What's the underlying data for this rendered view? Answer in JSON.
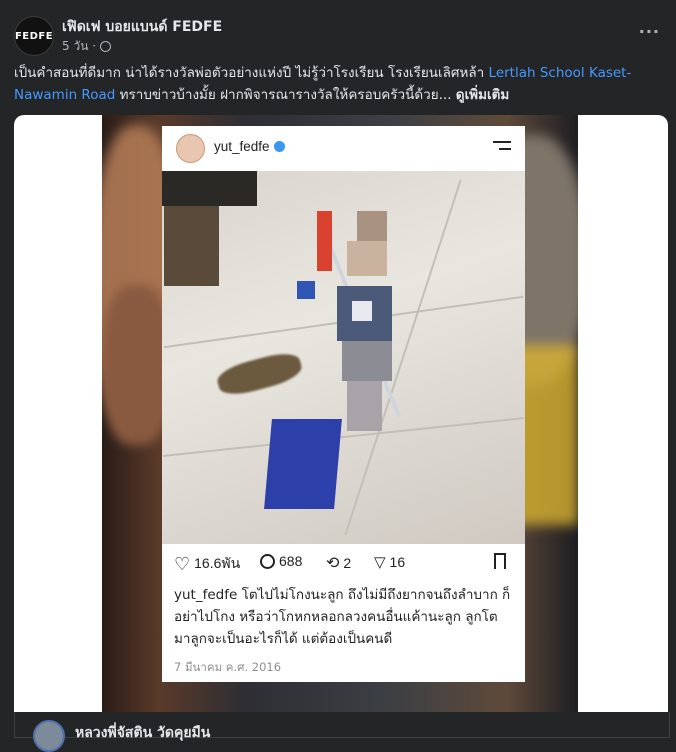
{
  "post": {
    "avatar_text": "FEDFE",
    "page_name": "เฟิดเฟ บอยแบนด์ FEDFE",
    "time": "5 วัน ·",
    "more": "···",
    "caption_text": "เป็นคำสอนที่ดีมาก น่าได้รางวัลพ่อตัวอย่างแห่งปี ไม่รู้ว่าโรงเรียน โรงเรียนเลิศหล้า ",
    "caption_link": "Lertlah School Kaset-Nawamin Road",
    "caption_text2": " ทราบข่าวบ้างมั้ย ฝากพิจารณารางวัลให้ครอบครัวนี้ด้วย... ",
    "see_more": "ดูเพิ่มเติม"
  },
  "ig": {
    "username": "yut_fedfe",
    "likes": "16.6พัน",
    "comments": "688",
    "reposts": "2",
    "shares": "16",
    "caption_user": "yut_fedfe",
    "caption": "โตไปไม่โกงนะลูก ถึงไม่มีถึงยากจนถึงลำบาก ก็อย่าไปโกง หรือว่าโกหกหลอกลวงคนอื่นแค้านะลูก ลูกโตมาลูกจะเป็นอะไรก็ได้ แต่ต้องเป็นคนดี",
    "date": "7 มีนาคม ค.ศ. 2016"
  },
  "comment": {
    "name": "หลวงพี่จัสติน วัดคุยมืน"
  }
}
